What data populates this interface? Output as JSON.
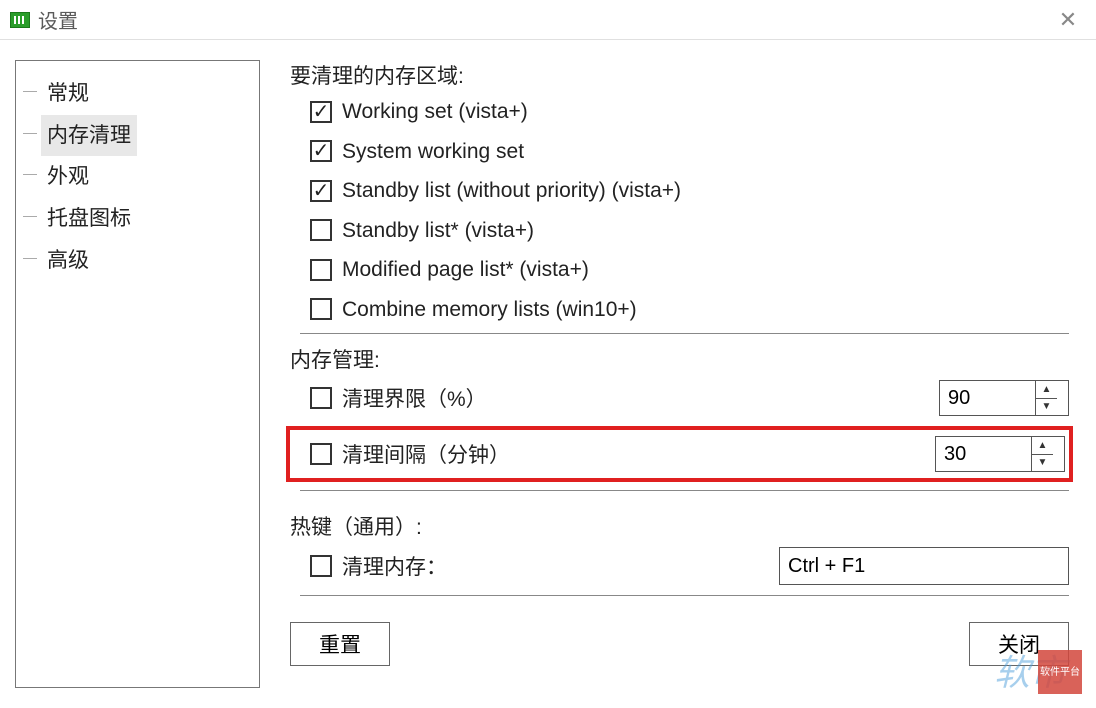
{
  "window": {
    "title": "设置"
  },
  "sidebar": {
    "items": [
      {
        "label": "常规",
        "selected": false
      },
      {
        "label": "内存清理",
        "selected": true
      },
      {
        "label": "外观",
        "selected": false
      },
      {
        "label": "托盘图标",
        "selected": false
      },
      {
        "label": "高级",
        "selected": false
      }
    ]
  },
  "memory_areas": {
    "title": "要清理的内存区域:",
    "options": [
      {
        "label": "Working set (vista+)",
        "checked": true
      },
      {
        "label": "System working set",
        "checked": true
      },
      {
        "label": "Standby list (without priority) (vista+)",
        "checked": true
      },
      {
        "label": "Standby list* (vista+)",
        "checked": false
      },
      {
        "label": "Modified page list* (vista+)",
        "checked": false
      },
      {
        "label": "Combine memory lists (win10+)",
        "checked": false
      }
    ]
  },
  "memory_manage": {
    "title": "内存管理:",
    "rows": [
      {
        "label": "清理界限（%）",
        "checked": false,
        "value": "90",
        "highlighted": false
      },
      {
        "label": "清理间隔（分钟）",
        "checked": false,
        "value": "30",
        "highlighted": true
      }
    ]
  },
  "hotkey": {
    "title": "热键（通用）:",
    "row": {
      "label": "清理内存：",
      "checked": false,
      "value": "Ctrl + F1"
    }
  },
  "buttons": {
    "reset": "重置",
    "close": "关闭"
  },
  "watermark": {
    "text": "软市",
    "badge": "软件平台"
  }
}
